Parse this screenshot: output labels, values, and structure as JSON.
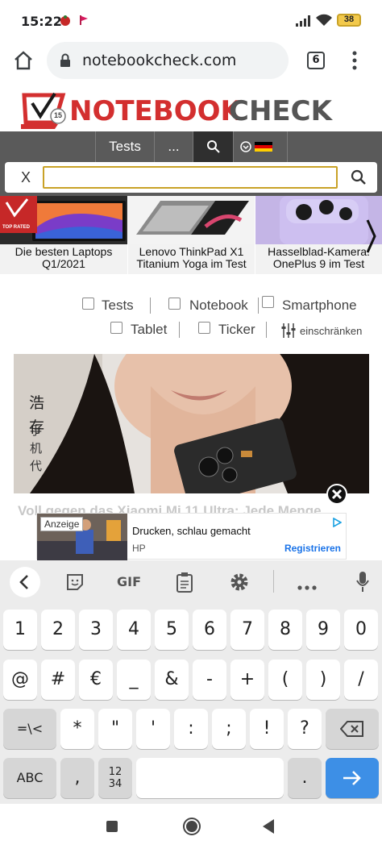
{
  "status_bar": {
    "time": "15:22",
    "battery": "38"
  },
  "browser": {
    "url": "notebookcheck.com",
    "tab_count": "6"
  },
  "site": {
    "logo_left": "NOTEBOOK",
    "logo_right": "CHECK",
    "logo_badge": "15",
    "nav": {
      "tests": "Tests",
      "more": "..."
    },
    "search_close": "X",
    "search_value": ""
  },
  "carousel": [
    {
      "caption": "Die besten Laptops Q1/2021",
      "badge": "TOP RATED"
    },
    {
      "caption": "Lenovo ThinkPad X1 Titanium Yoga im Test"
    },
    {
      "caption": "Hasselblad-Kamera: OnePlus 9 im Test"
    }
  ],
  "filters": {
    "tests": "Tests",
    "notebook": "Notebook",
    "smartphone": "Smartphone",
    "tablet": "Tablet",
    "ticker": "Ticker",
    "restrict": "einschränken"
  },
  "article": {
    "hero_chars": [
      "浩",
      "存"
    ],
    "headline": "Voll gegen das Xiaomi Mi 11 Ultra: Jede Menge"
  },
  "ad": {
    "badge": "Anzeige",
    "title": "Drucken, schlau gemacht",
    "advertiser": "HP",
    "cta": "Registrieren"
  },
  "keyboard": {
    "toolbar": {
      "gif": "GIF"
    },
    "row1": [
      "1",
      "2",
      "3",
      "4",
      "5",
      "6",
      "7",
      "8",
      "9",
      "0"
    ],
    "row2": [
      "@",
      "#",
      "€",
      "_",
      "&",
      "-",
      "+",
      "(",
      ")",
      "/"
    ],
    "row3_left": "=\\<",
    "row3": [
      "*",
      "\"",
      "'",
      ":",
      ";",
      "!",
      "?"
    ],
    "row4": {
      "abc": "ABC",
      "comma": ",",
      "numpad": "12\n34",
      "period": "."
    }
  }
}
